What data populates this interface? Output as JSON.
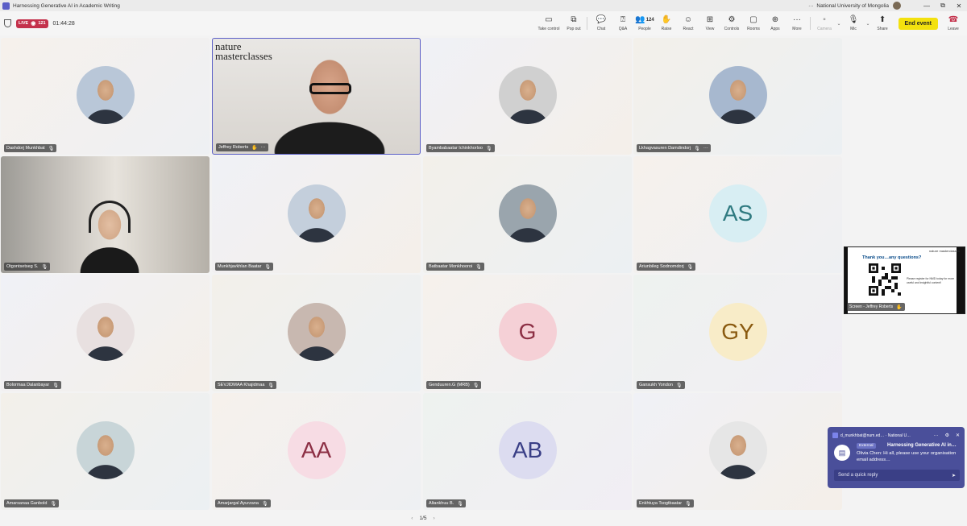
{
  "titlebar": {
    "title": "Harnessing Generative AI in Academic Writing",
    "more": "···",
    "org": "National University of Mongolia",
    "minimize": "—",
    "restore": "⧉",
    "close": "✕"
  },
  "toolbar": {
    "live_label": "LIVE",
    "viewer_count": "121",
    "timer": "01:44:28",
    "buttons": [
      {
        "id": "take-control",
        "label": "Take control",
        "icon": "▭"
      },
      {
        "id": "pop-out",
        "label": "Pop out",
        "icon": "⧉"
      },
      {
        "id": "chat",
        "label": "Chat",
        "icon": "💬"
      },
      {
        "id": "qa",
        "label": "Q&A",
        "icon": "⍰"
      },
      {
        "id": "people",
        "label": "People",
        "icon": "👥",
        "count": "124"
      },
      {
        "id": "raise",
        "label": "Raise",
        "icon": "✋"
      },
      {
        "id": "react",
        "label": "React",
        "icon": "☺"
      },
      {
        "id": "view",
        "label": "View",
        "icon": "⊞"
      },
      {
        "id": "controls",
        "label": "Controls",
        "icon": "⚙"
      },
      {
        "id": "rooms",
        "label": "Rooms",
        "icon": "▢"
      },
      {
        "id": "apps",
        "label": "Apps",
        "icon": "⊕"
      },
      {
        "id": "more",
        "label": "More",
        "icon": "···"
      }
    ],
    "camera_label": "Camera",
    "mic_label": "Mic",
    "share_label": "Share",
    "end_event_label": "End event",
    "leave_label": "Leave"
  },
  "participants": [
    {
      "name": "Dashdorj Munkhbat",
      "type": "photo",
      "color": "#b9c7d8"
    },
    {
      "name": "Jeffrey Roberts",
      "type": "video",
      "active": true,
      "brand": "nature masterclasses"
    },
    {
      "name": "Byambabaatar Ichinkhorloo",
      "type": "photo",
      "color": "#d0d0d0"
    },
    {
      "name": "Lkhagvasuren Damdindorj",
      "type": "photo",
      "color": "#a7b8cf"
    },
    {
      "name": "Otgontsetseg S.",
      "type": "video"
    },
    {
      "name": "Munkhjavkhlan Baatar",
      "type": "photo",
      "color": "#c4cfdc"
    },
    {
      "name": "Batbaatar Monkhooroi",
      "type": "photo",
      "color": "#9aa5ad"
    },
    {
      "name": "Ariunbileg Sodnomdorj",
      "type": "initials",
      "initials": "AS",
      "color": "#d8eef3",
      "text_color": "#2f7a80"
    },
    {
      "name": "Bolormaa Dalanbayar",
      "type": "photo",
      "color": "#e8e0e0"
    },
    {
      "name": "SEVJIDMAA Khajidmaa",
      "type": "photo",
      "color": "#c8b8b0"
    },
    {
      "name": "Genduuren.G (MRB)",
      "type": "initials",
      "initials": "G",
      "color": "#f5d0d6",
      "text_color": "#8c2f44"
    },
    {
      "name": "Gansukh Yondon",
      "type": "initials",
      "initials": "GY",
      "color": "#f8ecc8",
      "text_color": "#8a5a10"
    },
    {
      "name": "Amarsanaa Ganbold",
      "type": "photo",
      "color": "#c8d5d8"
    },
    {
      "name": "Amarjargal Ayurzana",
      "type": "initials",
      "initials": "AA",
      "color": "#f7dce4",
      "text_color": "#8c2f44"
    },
    {
      "name": "Altankhuu B.",
      "type": "initials",
      "initials": "AB",
      "color": "#dcdcf0",
      "text_color": "#3a3f86"
    },
    {
      "name": "Enkhtuya Tsogtbaatar",
      "type": "photo",
      "color": "#e6e6e6"
    }
  ],
  "pager": {
    "label": "1/5",
    "prev": "‹",
    "next": "›"
  },
  "screen_share": {
    "name": "Screen - Jeffrey Roberts",
    "title": "Thank you…any questions?",
    "brand": "nature masterclasses",
    "text": "Please register for NMD today for more useful and insightful content!"
  },
  "toast": {
    "sender": "d_munkhbat@num.ed… · National U…",
    "badge": "External",
    "title": "Harnessing Generative AI in…",
    "message": "Olivia Chen: Hi all, please use your organisation email address…",
    "reply_placeholder": "Send a quick reply"
  },
  "colors": {
    "accent": "#5b5fc7",
    "live": "#c4314b",
    "end_event": "#f3e10e"
  }
}
